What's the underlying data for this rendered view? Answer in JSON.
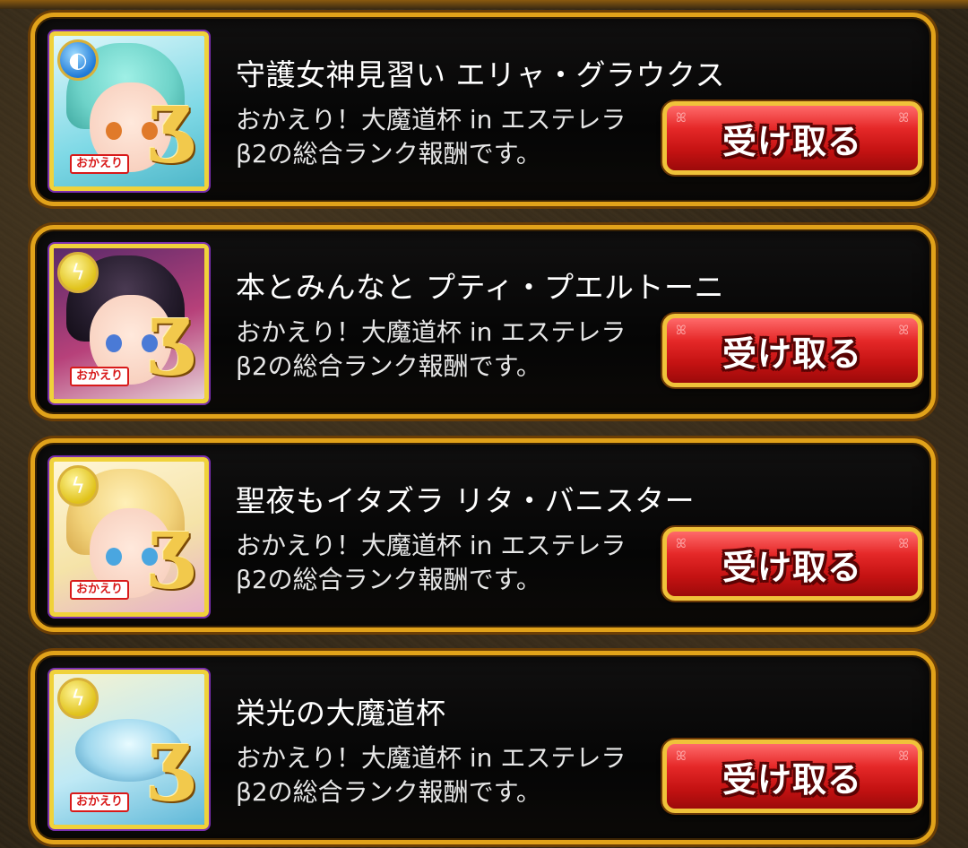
{
  "rewards": [
    {
      "title": "守護女神見習い エリャ・グラウクス",
      "description": "おかえり！大魔道杯 in エステレラβ2の総合ランク報酬です。",
      "badge": "おかえり",
      "element_icon": "water-orb-icon",
      "button_label": "受け取る",
      "art_colors": {
        "bg": "#7fd9e6",
        "hair": "#6ed3c9",
        "eye": "#e07a2a",
        "frame": "#f0d23a",
        "orb": "#1f7ad8"
      }
    },
    {
      "title": "本とみんなと プティ・プエルトーニ",
      "description": "おかえり！大魔道杯 in エステレラβ2の総合ランク報酬です。",
      "badge": "おかえり",
      "element_icon": "thunder-orb-icon",
      "button_label": "受け取る",
      "art_colors": {
        "bg": "#b7417a",
        "hair": "#241c2c",
        "eye": "#4a7ad6",
        "frame": "#f0d23a",
        "orb": "#e0c21a"
      }
    },
    {
      "title": "聖夜もイタズラ リタ・バニスター",
      "description": "おかえり！大魔道杯 in エステレラβ2の総合ランク報酬です。",
      "badge": "おかえり",
      "element_icon": "thunder-orb-icon",
      "button_label": "受け取る",
      "art_colors": {
        "bg": "#f5e3a8",
        "hair": "#f2d27a",
        "eye": "#4aa6e0",
        "frame": "#f0d23a",
        "orb": "#e0c21a"
      }
    },
    {
      "title": "栄光の大魔道杯",
      "description": "おかえり！大魔道杯 in エステレラβ2の総合ランク報酬です。",
      "badge": "おかえり",
      "element_icon": "thunder-orb-icon",
      "button_label": "受け取る",
      "art_colors": {
        "bg": "#bfe9f5",
        "hair": "#9fd8ee",
        "eye": "#6fb4e0",
        "frame": "#f0d23a",
        "orb": "#e0c21a"
      }
    }
  ]
}
